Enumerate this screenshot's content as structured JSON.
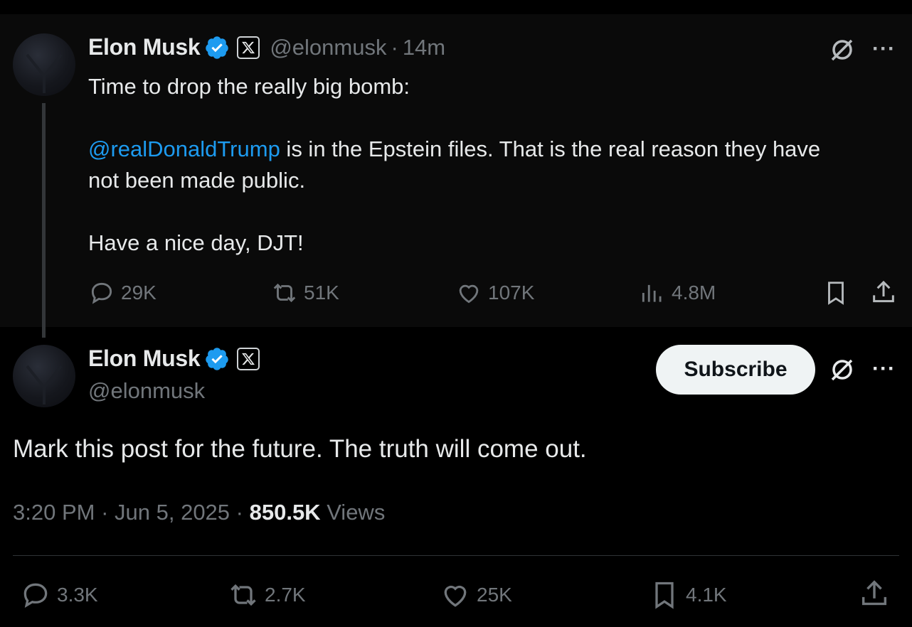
{
  "parent_post": {
    "author_name": "Elon Musk",
    "handle": "@elonmusk",
    "separator": "·",
    "time": "14m",
    "text_line1": "Time to drop the really big bomb:",
    "mention": "@realDonaldTrump",
    "text_line2_rest": " is in the Epstein files. That is the real reason they have",
    "text_line3": "not been made public.",
    "text_line4": "Have a nice day, DJT!",
    "more": "···",
    "actions": {
      "replies": "29K",
      "reposts": "51K",
      "likes": "107K",
      "views": "4.8M"
    }
  },
  "main_post": {
    "author_name": "Elon Musk",
    "handle": "@elonmusk",
    "subscribe_label": "Subscribe",
    "more": "···",
    "text": "Mark this post for the future. The truth will come out.",
    "time": "3:20 PM",
    "dot1": " · ",
    "date": "Jun 5, 2025",
    "dot2": " · ",
    "views_count": "850.5K",
    "views_label": " Views",
    "actions": {
      "replies": "3.3K",
      "reposts": "2.7K",
      "likes": "25K",
      "bookmarks": "4.1K"
    }
  },
  "colors": {
    "background": "#000000",
    "parent_background": "#0a0a0a",
    "text": "#e7e9ea",
    "muted": "#71767b",
    "link": "#1d9bf0",
    "verified": "#1d9bf0"
  },
  "icons": [
    "verified-badge-icon",
    "x-logo-icon",
    "grok-icon",
    "more-icon",
    "reply-icon",
    "repost-icon",
    "like-icon",
    "views-icon",
    "bookmark-icon",
    "share-icon"
  ]
}
